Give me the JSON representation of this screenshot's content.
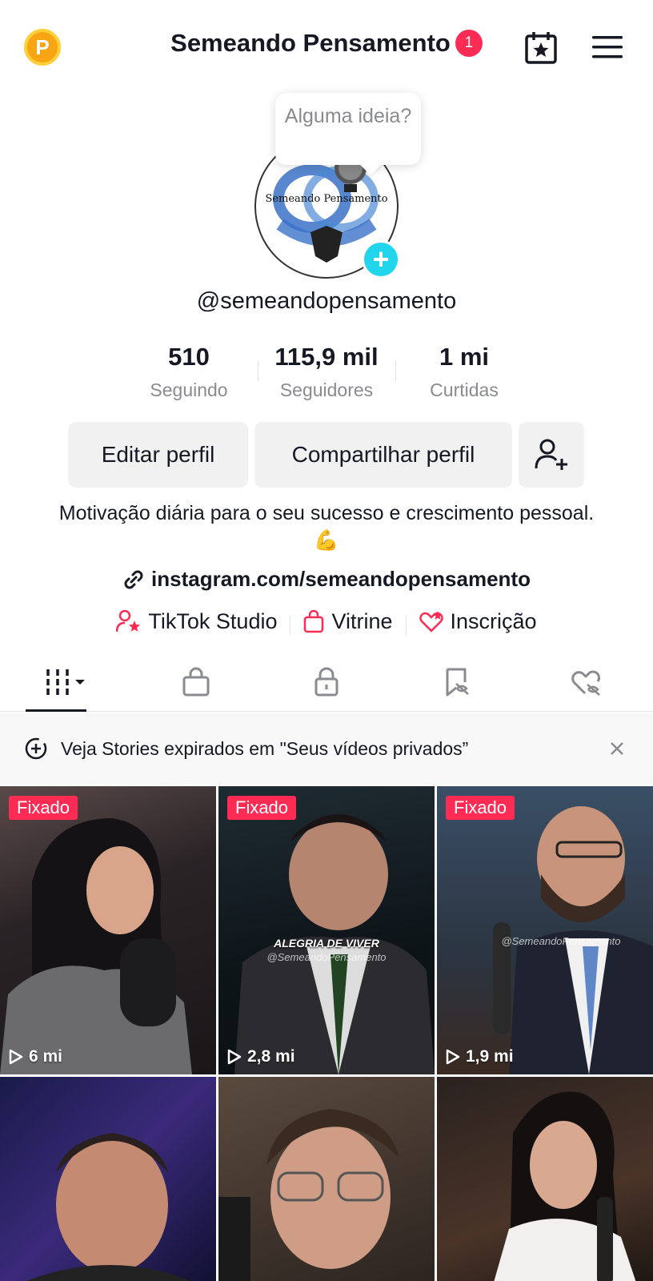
{
  "header": {
    "coin_letter": "P",
    "title": "Semeando Pensamento",
    "notification_count": "1"
  },
  "profile": {
    "bubble_text": "Alguma ideia?",
    "avatar_text": "Semeando Pensamento",
    "handle": "@semeandopensamento",
    "stats": [
      {
        "value": "510",
        "label": "Seguindo"
      },
      {
        "value": "115,9 mil",
        "label": "Seguidores"
      },
      {
        "value": "1 mi",
        "label": "Curtidas"
      }
    ],
    "buttons": {
      "edit": "Editar perfil",
      "share": "Compartilhar perfil"
    },
    "bio": "Motivação diária para o seu sucesso e crescimento pessoal. 💪",
    "link": "instagram.com/semeandopensamento",
    "shortcuts": [
      {
        "label": "TikTok Studio",
        "icon": "person-star-icon"
      },
      {
        "label": "Vitrine",
        "icon": "shopping-bag-icon"
      },
      {
        "label": "Inscrição",
        "icon": "heart-star-icon"
      }
    ]
  },
  "tabs": [
    {
      "name": "videos",
      "icon": "grid-icon",
      "active": true
    },
    {
      "name": "shop",
      "icon": "bag-icon"
    },
    {
      "name": "private",
      "icon": "lock-icon"
    },
    {
      "name": "favorites",
      "icon": "bookmark-hidden-icon"
    },
    {
      "name": "liked",
      "icon": "heart-hidden-icon"
    }
  ],
  "banner": {
    "text": "Veja Stories expirados em \"Seus vídeos privados”"
  },
  "videos": [
    {
      "pinned": "Fixado",
      "views": "6 mi"
    },
    {
      "pinned": "Fixado",
      "views": "2,8 mi",
      "caption": "ALEGRIA DE VIVER",
      "watermark": "@SemeandoPensamento"
    },
    {
      "pinned": "Fixado",
      "views": "1,9 mi",
      "watermark": "@SemeandoPensamento"
    },
    {},
    {},
    {}
  ],
  "colors": {
    "accent": "#fe2c55",
    "cyan": "#20d5ec",
    "coin": "#f7a513",
    "text": "#161823",
    "muted": "#8a8b91"
  }
}
